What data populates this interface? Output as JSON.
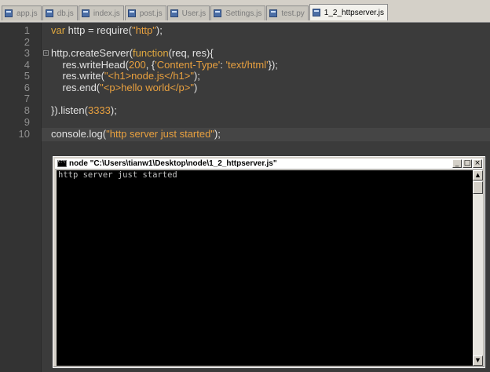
{
  "tabs": [
    {
      "label": "app.js"
    },
    {
      "label": "db.js"
    },
    {
      "label": "index.js"
    },
    {
      "label": "post.js"
    },
    {
      "label": "User.js"
    },
    {
      "label": "Settings.js"
    },
    {
      "label": "test.py"
    },
    {
      "label": "1_2_httpserver.js"
    }
  ],
  "active_tab": "1_2_httpserver.js",
  "editor": {
    "line_numbers": [
      "1",
      "2",
      "3",
      "4",
      "5",
      "6",
      "7",
      "8",
      "9",
      "10"
    ],
    "code": {
      "l1": {
        "kw": "var",
        "a": " http = require(",
        "s": "\"http\"",
        "b": ");"
      },
      "l3": {
        "a": "http.createServer(",
        "kw": "function",
        "b": "(req, res){"
      },
      "l4": {
        "a": "    res.writeHead(",
        "n": "200",
        "b": ", {",
        "s1": "'Content-Type'",
        "c": ": ",
        "s2": "'text/html'",
        "d": "});"
      },
      "l5": {
        "a": "    res.write(",
        "s": "\"<h1>node.js</h1>\"",
        "b": ");"
      },
      "l6": {
        "a": "    res.end(",
        "s": "\"<p>hello world</p>\"",
        "b": ")"
      },
      "l8": {
        "a": "}).listen(",
        "n": "3333",
        "b": ");"
      },
      "l10": {
        "a": "console.log(",
        "s": "\"http server just started\"",
        "b": ");"
      }
    }
  },
  "console": {
    "title": "node \"C:\\Users\\tianw1\\Desktop\\node\\1_2_httpserver.js\"",
    "output": "http server just started",
    "buttons": {
      "minimize": "_",
      "maximize": "□",
      "close": "×"
    },
    "scroll_up": "▲",
    "scroll_down": "▼"
  },
  "colors": {
    "editor_bg": "#3b3b3b",
    "keyword": "#e0a83f",
    "string": "#e8a03f",
    "console_bg": "#000000",
    "console_text": "#c0c0c0"
  },
  "icons": [
    "file-js-icon",
    "console-app-icon",
    "minimize-icon",
    "maximize-icon",
    "close-icon",
    "scroll-up-icon",
    "scroll-down-icon"
  ]
}
